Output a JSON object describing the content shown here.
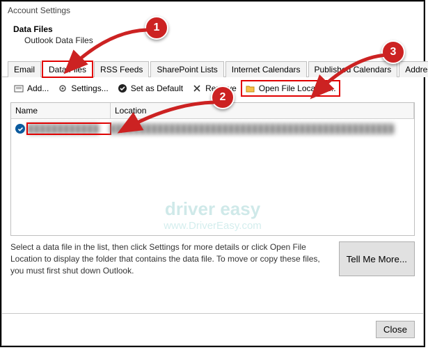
{
  "window": {
    "title": "Account Settings"
  },
  "header": {
    "heading": "Data Files",
    "sub": "Outlook Data Files"
  },
  "tabs": {
    "items": [
      {
        "label": "Email"
      },
      {
        "label": "Data Files"
      },
      {
        "label": "RSS Feeds"
      },
      {
        "label": "SharePoint Lists"
      },
      {
        "label": "Internet Calendars"
      },
      {
        "label": "Published Calendars"
      },
      {
        "label": "Address Books"
      }
    ]
  },
  "toolbar": {
    "add": "Add...",
    "settings": "Settings...",
    "set_default": "Set as Default",
    "remove": "Remove",
    "open_location": "Open File Location..."
  },
  "list": {
    "cols": {
      "name": "Name",
      "location": "Location"
    },
    "rows": [
      {
        "name": "████████████",
        "location": "████████████████████████████████████████████████"
      }
    ]
  },
  "help": {
    "text": "Select a data file in the list, then click Settings for more details or click Open File Location to display the folder that contains the data file. To move or copy these files, you must first shut down Outlook.",
    "tell_more": "Tell Me More..."
  },
  "bottom": {
    "close": "Close"
  },
  "watermark": {
    "line1": "driver easy",
    "line2": "www.DriverEasy.com"
  },
  "callouts": {
    "c1": "1",
    "c2": "2",
    "c3": "3"
  }
}
